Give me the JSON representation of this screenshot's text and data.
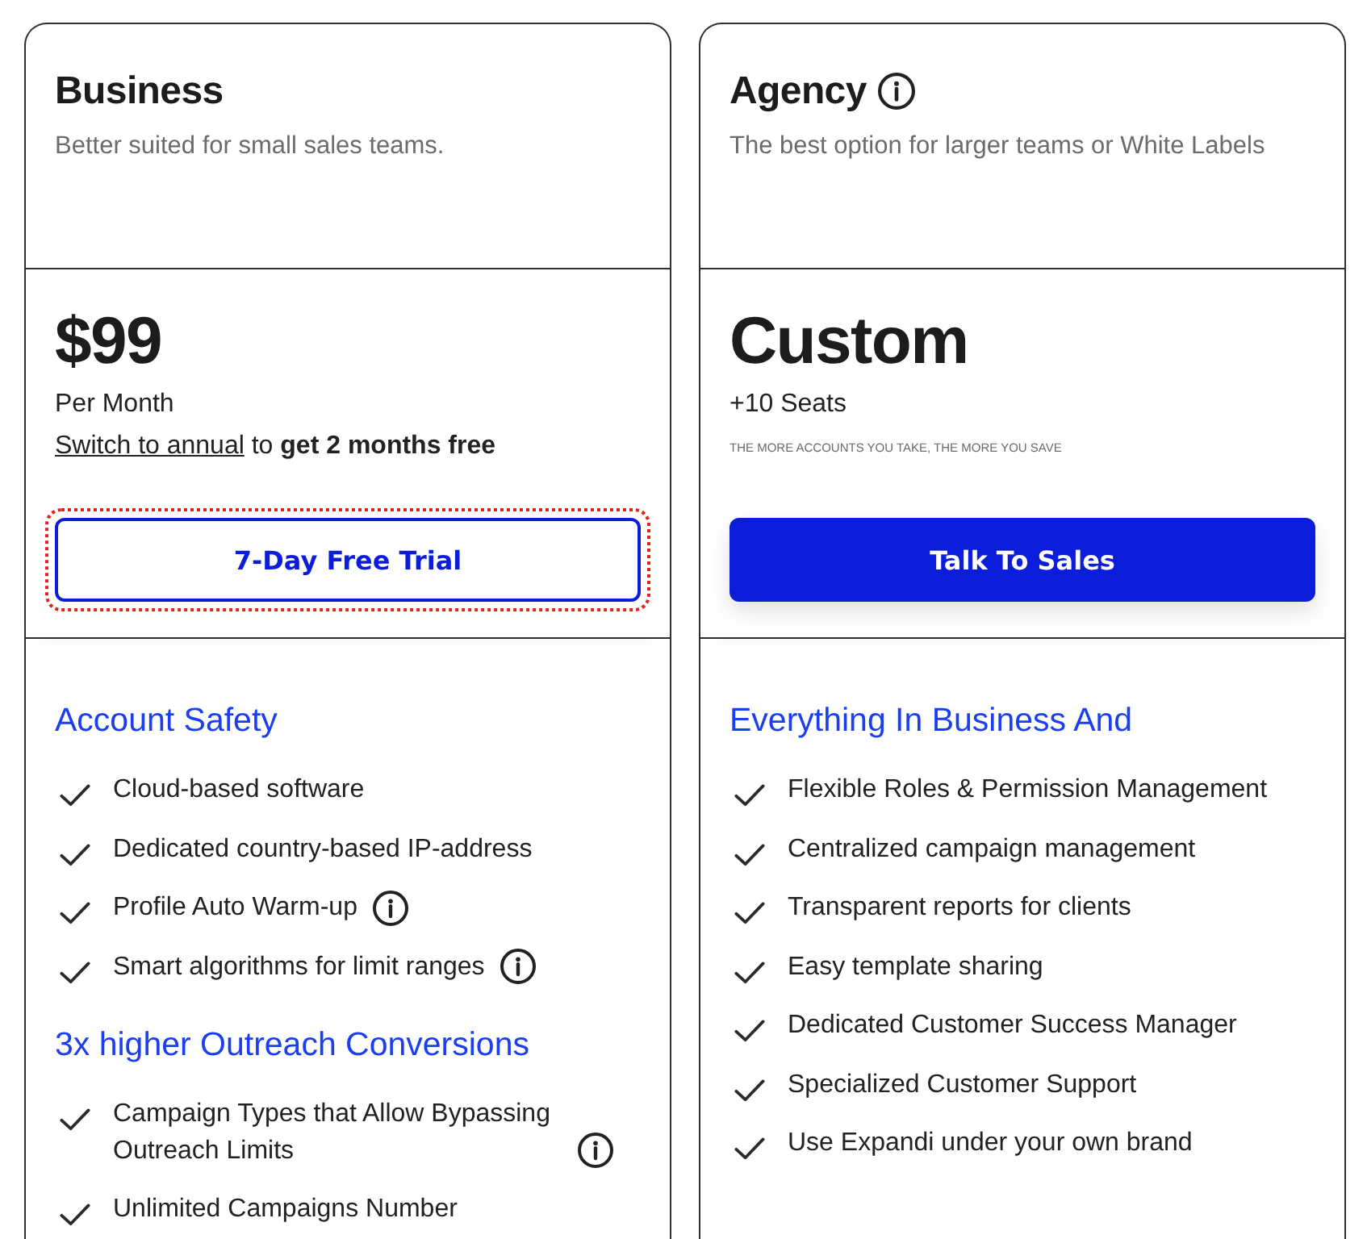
{
  "plans": [
    {
      "name": "Business",
      "info": false,
      "description": "Better suited for small sales teams.",
      "price": "$99",
      "period": "Per Month",
      "offer": {
        "link": "Switch to annual",
        "text": "to **get 2 months free**"
      },
      "button": {
        "label": "7-Day Free Trial",
        "kind": "outline",
        "focused": true
      },
      "groups": [
        {
          "title": "Account Safety",
          "features": [
            {
              "text": "Cloud-based software",
              "info": false
            },
            {
              "text": "Dedicated country-based IP-address",
              "info": false
            },
            {
              "text": "Profile Auto Warm-up",
              "info": true
            },
            {
              "text": "Smart algorithms for limit ranges",
              "info": true
            }
          ]
        },
        {
          "title": "3x higher Outreach Conversions",
          "features": [
            {
              "text": "Campaign Types that Allow Bypassing Outreach Limits",
              "info": true
            },
            {
              "text": "Unlimited Campaigns Number",
              "info": false
            }
          ]
        }
      ]
    },
    {
      "name": "Agency",
      "info": true,
      "description": "The best option for larger teams or White Labels",
      "price": "Custom",
      "period": "+10 Seats",
      "small_print": "THE MORE ACCOUNTS YOU TAKE, THE MORE YOU SAVE",
      "button": {
        "label": "Talk To Sales",
        "kind": "filled",
        "focused": false
      },
      "groups": [
        {
          "title": "Everything In Business And",
          "features": [
            {
              "text": "Flexible Roles & Permission Management",
              "info": false
            },
            {
              "text": "Centralized campaign management",
              "info": false
            },
            {
              "text": "Transparent reports for clients",
              "info": false
            },
            {
              "text": "Easy template sharing",
              "info": false
            },
            {
              "text": "Dedicated Customer Success Manager",
              "info": false
            },
            {
              "text": "Specialized Customer Support",
              "info": false
            },
            {
              "text": "Use Expandi under your own brand",
              "info": false
            }
          ]
        }
      ]
    }
  ]
}
